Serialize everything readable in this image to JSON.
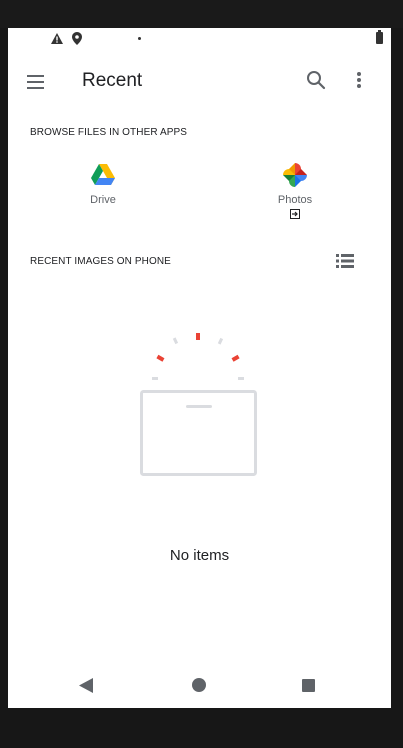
{
  "app_bar": {
    "title": "Recent"
  },
  "sections": {
    "browse_label": "BROWSE FILES IN OTHER APPS",
    "recent_label": "RECENT IMAGES ON PHONE"
  },
  "apps": [
    {
      "label": "Drive",
      "icon": "google-drive-icon"
    },
    {
      "label": "Photos",
      "icon": "google-photos-icon",
      "badge_icon": "open-in-app-icon"
    }
  ],
  "empty_state": {
    "message": "No items"
  },
  "icons": {
    "menu": "hamburger-menu-icon",
    "search": "search-icon",
    "more": "more-vert-icon",
    "list_view": "list-view-icon",
    "status": [
      "warning-icon",
      "location-icon",
      "notification-dot-icon",
      "battery-icon"
    ],
    "nav": [
      "back-icon",
      "home-icon",
      "recents-icon"
    ]
  },
  "colors": {
    "background": "#ffffff",
    "text_primary": "#202124",
    "text_secondary": "#5f6368",
    "accent_red": "#ea4335"
  }
}
